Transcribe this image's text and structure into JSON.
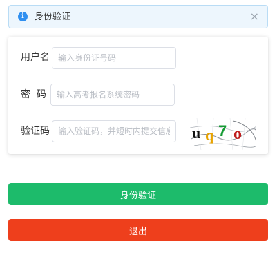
{
  "alert": {
    "text": "身份验证",
    "icon": "info-icon",
    "close_icon": "close-icon",
    "close_glyph": "×",
    "info_glyph": "i",
    "color": "#2f8ff0"
  },
  "form": {
    "username": {
      "label": "用户名",
      "placeholder": "输入身份证号码",
      "value": ""
    },
    "password": {
      "label": "密  码",
      "placeholder": "输入高考报名系统密码",
      "value": ""
    },
    "captcha": {
      "label": "验证码",
      "placeholder": "输入验证码，并短时内提交信息",
      "value": "",
      "image_text": "uq7o"
    }
  },
  "buttons": {
    "verify": {
      "label": "身份验证",
      "color": "#1dbb6b"
    },
    "exit": {
      "label": "退出",
      "color": "#ee3f1c"
    }
  }
}
